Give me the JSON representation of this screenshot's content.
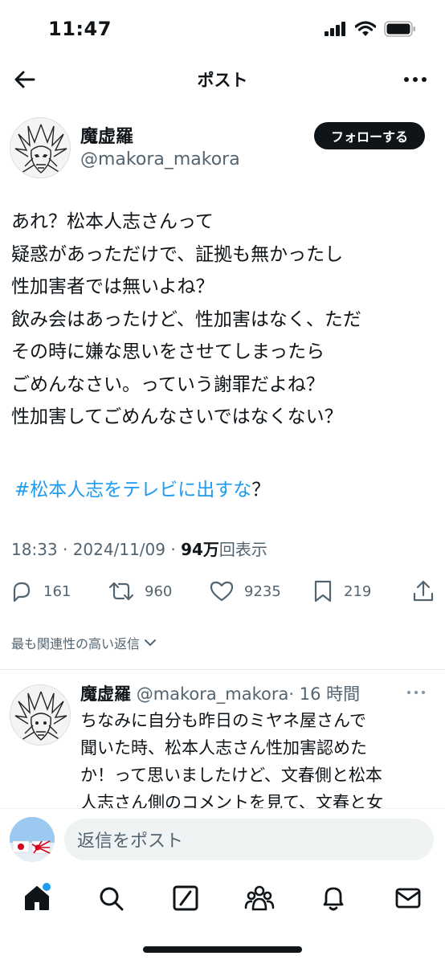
{
  "status_bar": {
    "time": "11:47"
  },
  "header": {
    "title": "ポスト"
  },
  "author": {
    "name": "魔虚羅",
    "handle": "@makora_makora"
  },
  "follow_button": "フォローする",
  "post": {
    "lines": [
      "あれ？松本人志さんって",
      "疑惑があっただけで、証拠も無かったし",
      "性加害者では無いよね？",
      "飲み会はあったけど、性加害はなく、ただ",
      "その時に嫌な思いをさせてしまったら",
      "ごめんなさい。っていう謝罪だよね？",
      "性加害してごめんなさいではなくない？"
    ],
    "hashtag": "#松本人志をテレビに出すな",
    "hashtag_suffix": "？",
    "time": "18:33 · 2024/11/09 · ",
    "views": "94万",
    "views_label": "回表示"
  },
  "actions": {
    "replies": "161",
    "reposts": "960",
    "likes": "9235",
    "bookmarks": "219"
  },
  "relevance_label": "最も関連性の高い返信",
  "reply": {
    "name": "魔虚羅",
    "handle": "@makora_makora",
    "time": "· 16 時間",
    "lines": [
      "ちなみに自分も昨日のミヤネ屋さんで",
      "聞いた時、松本人志さん性加害認めた",
      "か！って思いましたけど、文春側と松本",
      "人志さん側のコメントを見て、文春と女"
    ]
  },
  "compose": {
    "placeholder": "返信をポスト"
  },
  "colors": {
    "accent": "#1d9bf0",
    "text": "#0f1419",
    "secondary": "#536471"
  },
  "nav": [
    "home-icon",
    "search-icon",
    "grok-icon",
    "communities-icon",
    "notifications-icon",
    "messages-icon"
  ]
}
